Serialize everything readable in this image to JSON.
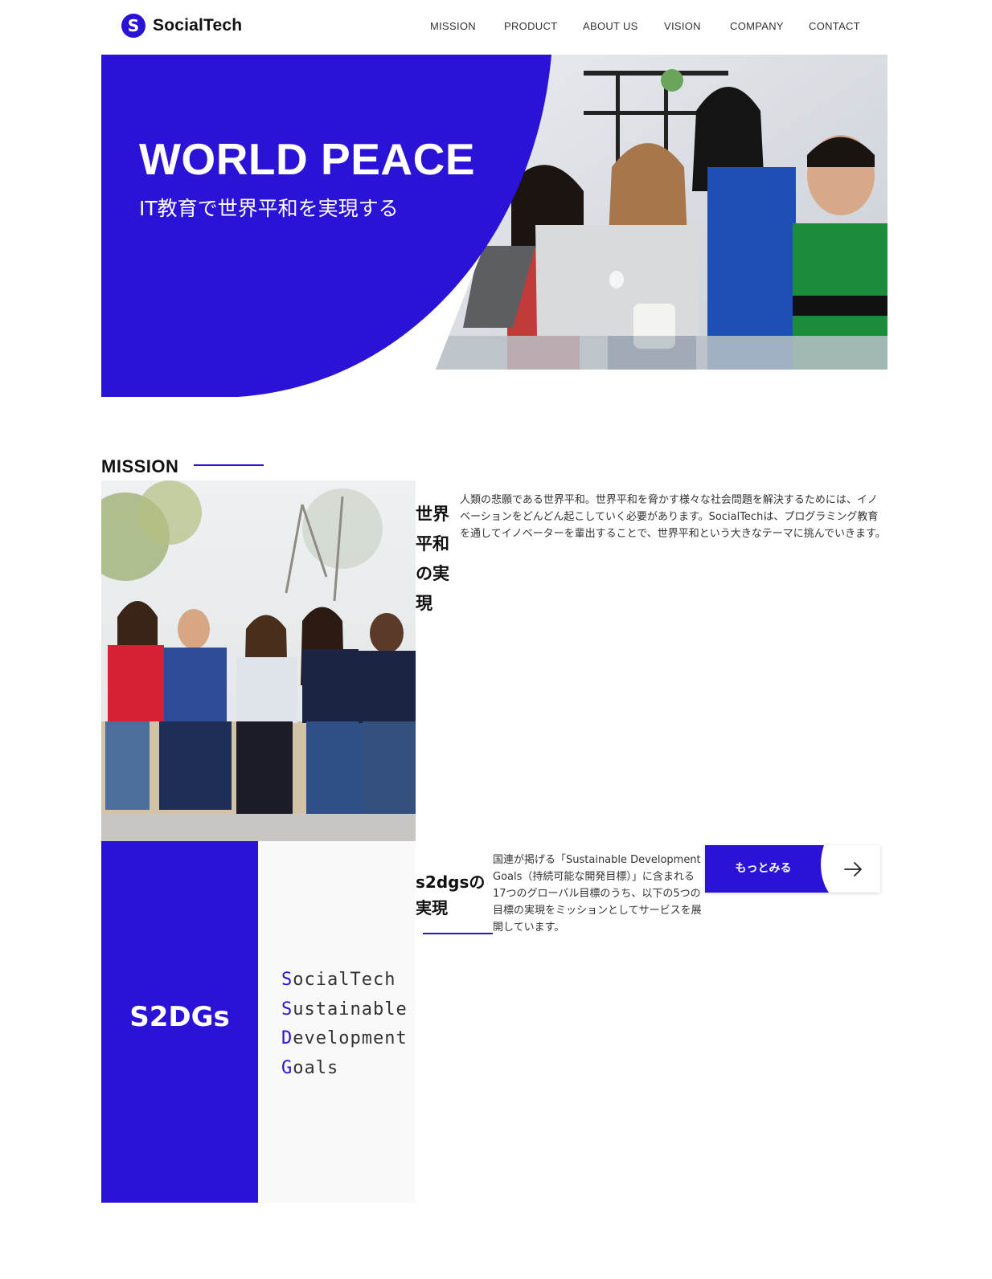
{
  "brand": {
    "name": "SocialTech",
    "icon": "logo-s-icon",
    "color": "#2a12d6"
  },
  "nav": {
    "items": [
      {
        "label": "MISSION"
      },
      {
        "label": "PRODUCT"
      },
      {
        "label": "ABOUT US"
      },
      {
        "label": "VISION"
      },
      {
        "label": "COMPANY"
      },
      {
        "label": "CONTACT"
      }
    ]
  },
  "hero": {
    "title": "WORLD PEACE",
    "subtitle": "IT教育で世界平和を実現する"
  },
  "mission": {
    "heading": "MISSION",
    "item1": {
      "heading": "世界平和の実現",
      "body": "人類の悲願である世界平和。世界平和を脅かす様々な社会問題を解決するためには、イノベーションをどんどん起こしていく必要があります。SocialTechは、プログラミング教育を通してイノベーターを輩出することで、世界平和という大きなテーマに挑んでいきます。"
    },
    "item2": {
      "heading": "s2dgsの実現",
      "body": "国連が掲げる「Sustainable Development Goals（持続可能な開発目標）」に含まれる17つのグローバル目標のうち、以下の5つの目標の実現をミッションとしてサービスを展開しています。",
      "button_label": "もっとみる",
      "button_icon": "arrow-right-icon"
    }
  },
  "s2dgs": {
    "title": "S2DGs",
    "words": [
      {
        "first": "S",
        "rest": "ocialTech"
      },
      {
        "first": "S",
        "rest": "ustainable"
      },
      {
        "first": "D",
        "rest": "evelopment"
      },
      {
        "first": "G",
        "rest": "oals"
      }
    ]
  }
}
